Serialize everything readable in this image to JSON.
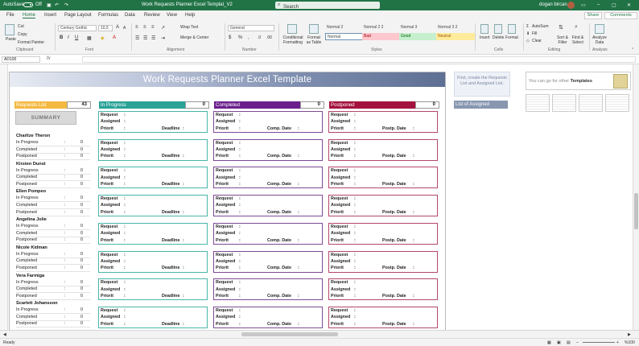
{
  "titlebar": {
    "autosave_label": "AutoSave",
    "autosave_state": "Off",
    "document_title": "Work Requests Planner Excel Templat_V2",
    "search_placeholder": "Search",
    "user_name": "dogan bircan"
  },
  "menu": {
    "items": [
      "File",
      "Home",
      "Insert",
      "Page Layout",
      "Formulas",
      "Data",
      "Review",
      "View",
      "Help"
    ],
    "active": "Home",
    "share_label": "Share",
    "comments_label": "Comments"
  },
  "ribbon": {
    "clipboard": {
      "paste": "Paste",
      "cut": "Cut",
      "copy": "Copy",
      "format_painter": "Format Painter",
      "label": "Clipboard"
    },
    "font": {
      "family": "Century Gothic",
      "size": "10,5",
      "label": "Font"
    },
    "alignment": {
      "wrap_text": "Wrap Text",
      "merge_center": "Merge & Center",
      "label": "Alignment"
    },
    "number": {
      "format": "General",
      "label": "Number"
    },
    "styles": {
      "conditional_formatting": "Conditional Formatting",
      "format_as_table": "Format as Table",
      "cells": [
        {
          "name": "Normal 2",
          "style": "plain"
        },
        {
          "name": "Normal 2 2",
          "style": "plain"
        },
        {
          "name": "Normal 3",
          "style": "plain"
        },
        {
          "name": "Normal 3 2",
          "style": "plain"
        },
        {
          "name": "Normal",
          "style": "normal"
        },
        {
          "name": "Bad",
          "style": "bad"
        },
        {
          "name": "Good",
          "style": "good"
        },
        {
          "name": "Neutral",
          "style": "neutral"
        }
      ],
      "label": "Styles"
    },
    "cells": {
      "insert": "Insert",
      "delete": "Delete",
      "format": "Format",
      "label": "Cells"
    },
    "editing": {
      "autosum": "AutoSum",
      "fill": "Fill",
      "clear": "Clear",
      "sort_filter": "Sort & Filter",
      "find_select": "Find & Select",
      "label": "Editing"
    },
    "analysis": {
      "analyze_data": "Analyze Data",
      "label": "Analysis"
    }
  },
  "formula_bar": {
    "name_box": "AD100",
    "fx": "fx",
    "value": ""
  },
  "sheet": {
    "title": "Work Requests Planner Excel Template",
    "summary_label": "SUMMARY",
    "requests_list": {
      "label": "Requests List",
      "count": "43",
      "color": "#f4b942"
    },
    "columns": [
      {
        "label": "In Progress",
        "count": "0",
        "color": "#2aa296",
        "border": "#48b6a7",
        "third_label": "Deadline"
      },
      {
        "label": "Completed",
        "count": "0",
        "color": "#6a1f8c",
        "border": "#7d4a94",
        "third_label": "Comp. Date"
      },
      {
        "label": "Postponed",
        "count": "0",
        "color": "#a3123e",
        "border": "#b2476a",
        "third_label": "Postp. Date"
      }
    ],
    "card_fields": [
      "Request",
      "Assigned",
      "Priorit"
    ],
    "people": [
      {
        "name": "Charlize Theron"
      },
      {
        "name": "Kirsten Dunst"
      },
      {
        "name": "Ellen Pompeo"
      },
      {
        "name": "Angelina Jolie"
      },
      {
        "name": "Nicole Kidman"
      },
      {
        "name": "Vera Farmiga"
      },
      {
        "name": "Scarlett Johansson"
      }
    ],
    "status_labels": [
      "In Progress",
      "Completed",
      "Postponed"
    ],
    "status_value": "0",
    "side_note": "First, create the Requests List and Assigned List.",
    "assigned_list_label": "List of Assigned",
    "ad": {
      "prefix": "You can go for other ",
      "bold": "Templates"
    }
  },
  "statusbar": {
    "ready": "Ready",
    "zoom": "%100"
  }
}
